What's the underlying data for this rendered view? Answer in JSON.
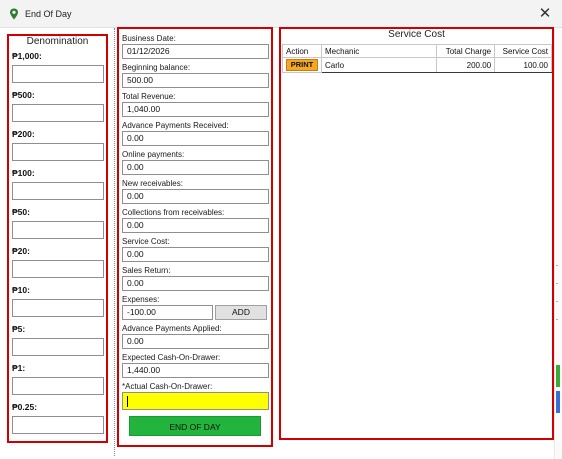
{
  "window": {
    "title": "End Of Day",
    "icon": "map-pin-icon",
    "close_glyph": "✕"
  },
  "denomination": {
    "title": "Denomination",
    "items": [
      {
        "label": "₱1,000:"
      },
      {
        "label": "₱500:"
      },
      {
        "label": "₱200:"
      },
      {
        "label": "₱100:"
      },
      {
        "label": "₱50:"
      },
      {
        "label": "₱20:"
      },
      {
        "label": "₱10:"
      },
      {
        "label": "₱5:"
      },
      {
        "label": "₱1:"
      },
      {
        "label": "₱0.25:"
      }
    ]
  },
  "summary": {
    "business_date": {
      "label": "Business Date:",
      "value": "01/12/2026"
    },
    "beginning_balance": {
      "label": "Beginning balance:",
      "value": "500.00"
    },
    "total_revenue": {
      "label": "Total Revenue:",
      "value": "1,040.00"
    },
    "advance_payments_received": {
      "label": "Advance Payments Received:",
      "value": "0.00"
    },
    "online_payments": {
      "label": "Online payments:",
      "value": "0.00"
    },
    "new_receivables": {
      "label": "New receivables:",
      "value": "0.00"
    },
    "collections_from_receivables": {
      "label": "Collections from receivables:",
      "value": "0.00"
    },
    "service_cost": {
      "label": "Service Cost:",
      "value": "0.00"
    },
    "sales_return": {
      "label": "Sales Return:",
      "value": "0.00"
    },
    "expenses": {
      "label": "Expenses:",
      "value": "-100.00",
      "add_label": "ADD"
    },
    "advance_payments_applied": {
      "label": "Advance Payments Applied:",
      "value": "0.00"
    },
    "expected_cash": {
      "label": "Expected Cash-On-Drawer:",
      "value": "1,440.00"
    },
    "actual_cash": {
      "label": "*Actual Cash-On-Drawer:",
      "value": ""
    },
    "end_of_day_label": "END OF DAY"
  },
  "service_cost": {
    "title": "Service Cost",
    "columns": [
      "Action",
      "Mechanic",
      "Total Charge",
      "Service Cost"
    ],
    "rows": [
      {
        "action": "PRINT",
        "mechanic": "Carlo",
        "total_charge": "200.00",
        "service_cost": "100.00"
      }
    ]
  },
  "colors": {
    "panel_border": "#d00000",
    "actual_cash_bg": "#ffff00",
    "end_of_day_bg": "#22b43c",
    "print_bg": "#f5a623"
  }
}
